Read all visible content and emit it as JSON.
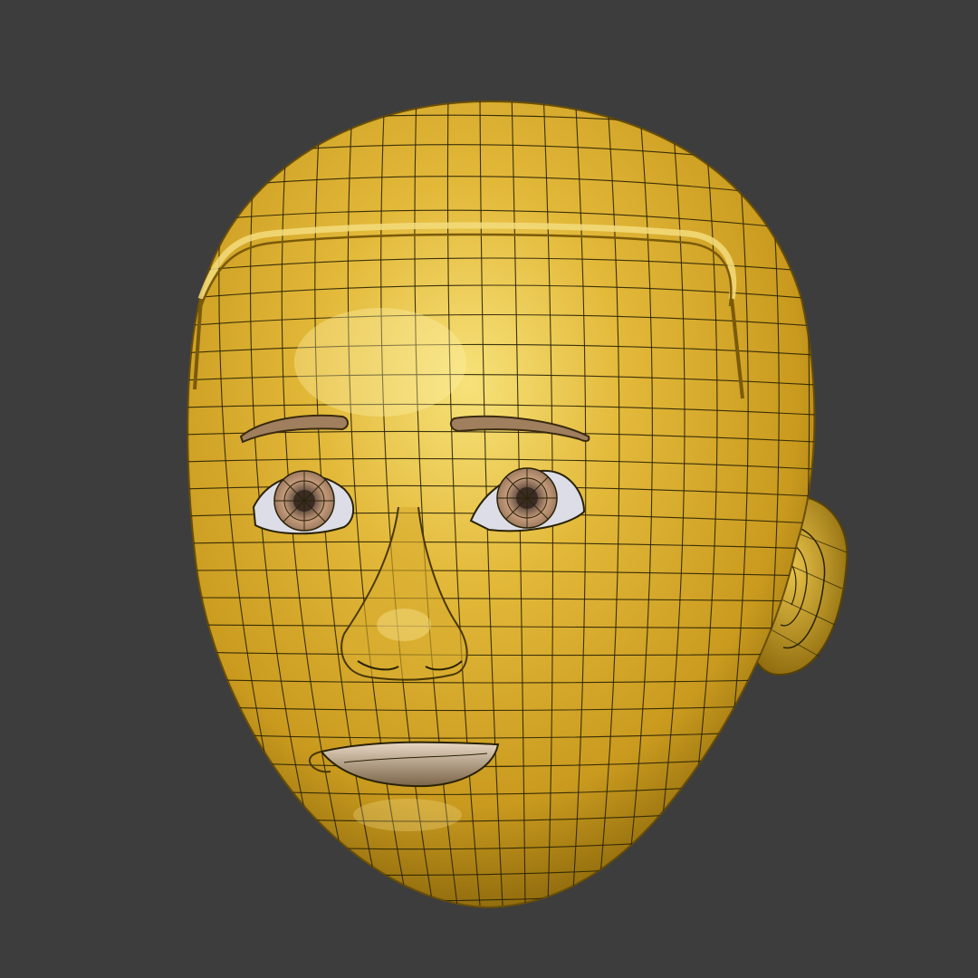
{
  "scene": {
    "background": "#3d3d3d",
    "subject": "head-wireframe-icon",
    "colors": {
      "gold_light": "#f4dc6a",
      "gold_mid": "#d9ad2a",
      "gold_dark": "#8a6606",
      "wire": "#2a2206",
      "brow": "#9a7a5a",
      "iris": "#b48a6e",
      "sclera": "#dcdde6"
    }
  }
}
